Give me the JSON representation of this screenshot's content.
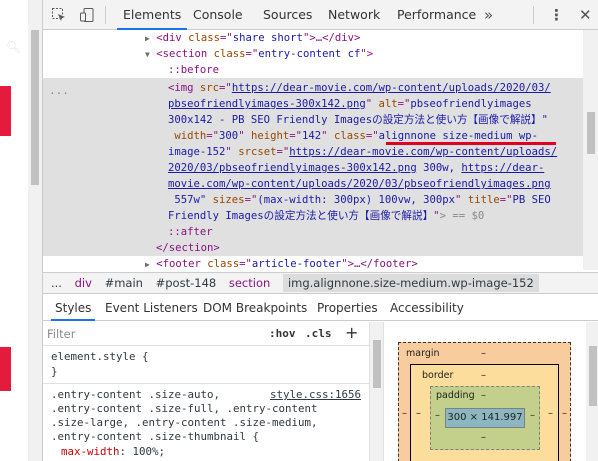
{
  "toolbar": {
    "inspect_icon": "inspect-cursor-icon",
    "device_icon": "device-toggle-icon",
    "tabs": [
      {
        "label": "Elements"
      },
      {
        "label": "Console"
      },
      {
        "label": "Sources"
      },
      {
        "label": "Network"
      },
      {
        "label": "Performance"
      }
    ],
    "more": "»",
    "kebab": "⋮",
    "close": "✕",
    "accent": "#1a73e8"
  },
  "tree": {
    "ellipsis": "...",
    "l1": {
      "tag_open": "<div",
      "attr": "class",
      "val": "share short",
      "tail": ">…</div>"
    },
    "l2": {
      "tag_open": "<section",
      "attr": "class",
      "val": "entry-content cf",
      "tail": ">"
    },
    "l3": "::before",
    "l4_tag": "<img",
    "l4_attr": "src",
    "l4_src_a": "https://dear-movie.com/wp-content/uploads/2020/03/",
    "l5_src_b": "pbseofriendlyimages-300x142.png",
    "l5_alt_attr": "alt",
    "l5_alt_val": "pbseofriendlyimages",
    "l6": "300x142 - PB SEO Friendly Imagesの設定方法と使い方【画像で解説】\"",
    "l7_width_attr": "width",
    "l7_width": "300",
    "l7_height_attr": "height",
    "l7_height": "142",
    "l7_class_attr": "class",
    "l7_class": "alignnone size-medium wp-",
    "l8_class_b": "image-152",
    "l8_srcset_attr": "srcset",
    "l8_srcset_a": "https://dear-movie.com/wp-content/uploads/",
    "l9_srcset_b": "2020/03/pbseofriendlyimages-300x142.png",
    "l9_w1": " 300w, ",
    "l9_srcset_c": "https://dear-",
    "l10_srcset_d": "movie.com/wp-content/uploads/2020/03/pbseofriendlyimages.png",
    "l11_w2": " 557w\"",
    "l11_sizes_attr": "sizes",
    "l11_sizes": "(max-width: 300px) 100vw, 300px",
    "l11_title_attr": "title",
    "l11_title_a": "PB SEO",
    "l12_title_b": "Friendly Imagesの設定方法と使い方【画像で解説】",
    "l12_tail": "> == $0",
    "l13": "::after",
    "l14": "</section>",
    "l15": {
      "tag_open": "<footer",
      "attr": "class",
      "val": "article-footer",
      "tail": ">…</footer>"
    },
    "highlight_color": "#e00022"
  },
  "breadcrumb": {
    "items": [
      "...",
      "div",
      "#main",
      "#post-148",
      "section",
      "img.alignnone.size-medium.wp-image-152"
    ]
  },
  "subtabs": [
    "Styles",
    "Event Listeners",
    "DOM Breakpoints",
    "Properties",
    "Accessibility"
  ],
  "styles": {
    "filter_placeholder": "Filter",
    "hov": ":hov",
    "cls": ".cls",
    "plus": "+",
    "element_style": "element.style {",
    "element_style_close": "}",
    "rule_selectors": [
      ".entry-content .size-auto,",
      ".entry-content .size-full, .entry-content",
      ".size-large, .entry-content .size-medium,",
      ".entry-content .size-thumbnail {"
    ],
    "rule_source": "style.css:1656",
    "rule_prop": "max-width",
    "rule_val": "100%;"
  },
  "boxmodel": {
    "margin_label": "margin",
    "border_label": "border",
    "padding_label": "padding",
    "dash": "–",
    "content_size": "300 × 141.997"
  }
}
